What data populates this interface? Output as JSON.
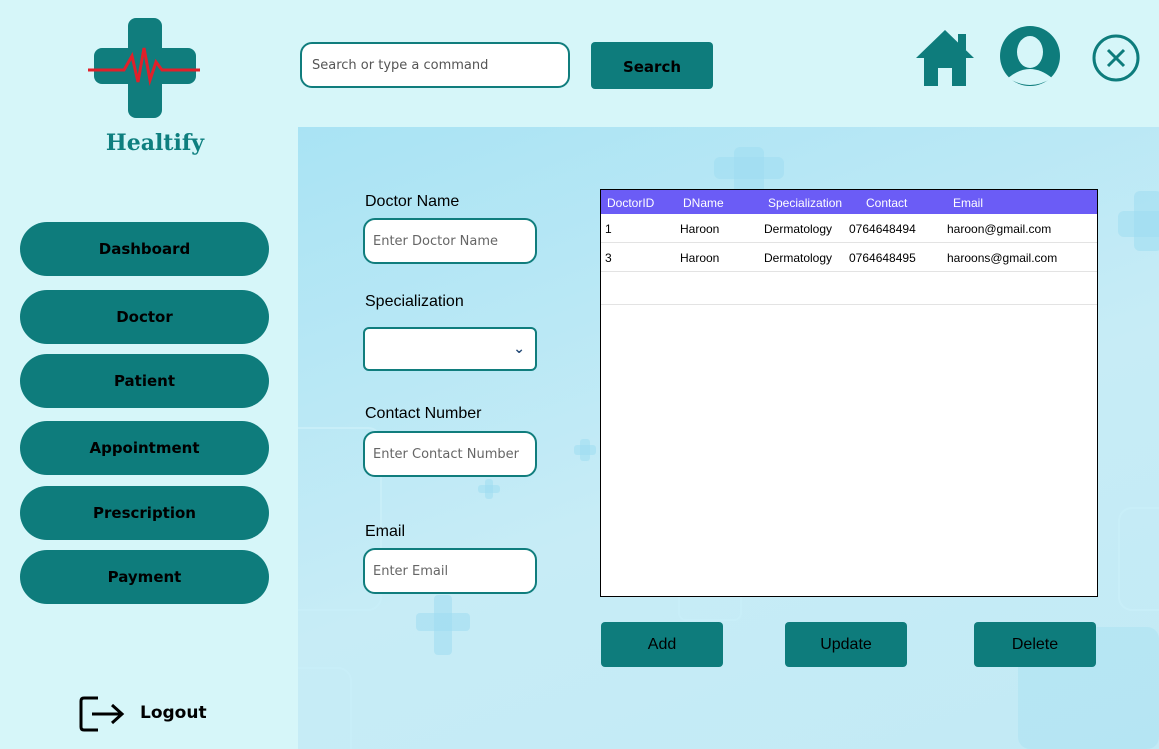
{
  "app": {
    "name": "Healtify"
  },
  "header": {
    "search_placeholder": "Search or type a command",
    "search_label": "Search"
  },
  "sidebar": {
    "items": [
      {
        "label": "Dashboard"
      },
      {
        "label": "Doctor"
      },
      {
        "label": "Patient"
      },
      {
        "label": "Appointment"
      },
      {
        "label": "Prescription"
      },
      {
        "label": "Payment"
      }
    ],
    "logout_label": "Logout"
  },
  "form": {
    "doctor_name_label": "Doctor Name",
    "doctor_name_placeholder": "Enter Doctor Name",
    "specialization_label": "Specialization",
    "specialization_value": "",
    "contact_label": "Contact Number",
    "contact_placeholder": "Enter Contact Number",
    "email_label": "Email",
    "email_placeholder": "Enter Email"
  },
  "table": {
    "columns": [
      "DoctorID",
      "DName",
      "Specialization",
      "Contact",
      "Email"
    ],
    "rows": [
      [
        "1",
        "Haroon",
        "Dermatology",
        "0764648494",
        "haroon@gmail.com"
      ],
      [
        "3",
        "Haroon",
        "Dermatology",
        "0764648495",
        "haroons@gmail.com"
      ]
    ]
  },
  "actions": {
    "add_label": "Add",
    "update_label": "Update",
    "delete_label": "Delete"
  },
  "colors": {
    "background": "#d6f6f9",
    "primary": "#0e7c7c",
    "grid_header": "#6b5cf6",
    "logo_red": "#e0202a"
  },
  "icons": [
    "logo-cross-icon",
    "home-icon",
    "user-avatar-icon",
    "close-icon",
    "logout-icon",
    "chevron-down-icon"
  ]
}
